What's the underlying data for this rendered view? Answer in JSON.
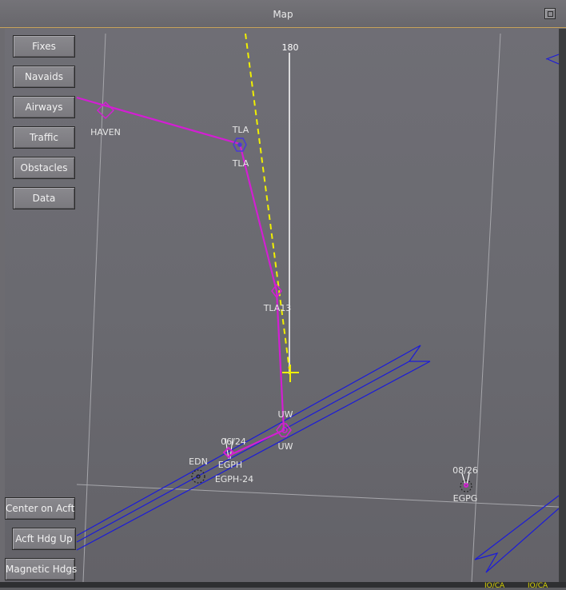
{
  "window": {
    "title": "Map"
  },
  "buttons": {
    "fixes": "Fixes",
    "navaids": "Navaids",
    "airways": "Airways",
    "traffic": "Traffic",
    "obstacles": "Obstacles",
    "data": "Data",
    "center_on_acft": "Center on Acft",
    "acft_hdg_up": "Acft Hdg Up",
    "magnetic_hdgs": "Magnetic Hdgs"
  },
  "map": {
    "heading_label": "180",
    "fixes": {
      "haven": "HAVEN",
      "tla_top": "TLA",
      "tla_bottom": "TLA",
      "tla13": "TLA13",
      "uw_top": "UW",
      "uw_bottom": "UW",
      "edn": "EDN"
    },
    "airports": {
      "egph": "EGPH",
      "egph_runway": "06/24",
      "egph_ils": "EGPH-24",
      "egpg": "EGPG",
      "egpg_runway": "08/26"
    },
    "colors": {
      "route": "#d21fd2",
      "airway": "#1b1bd9",
      "track": "#f0f000",
      "heading_line": "#ffffff",
      "grid": "#a3a3a8"
    }
  },
  "status": {
    "left": "IO/CA",
    "right": "IO/CA"
  }
}
